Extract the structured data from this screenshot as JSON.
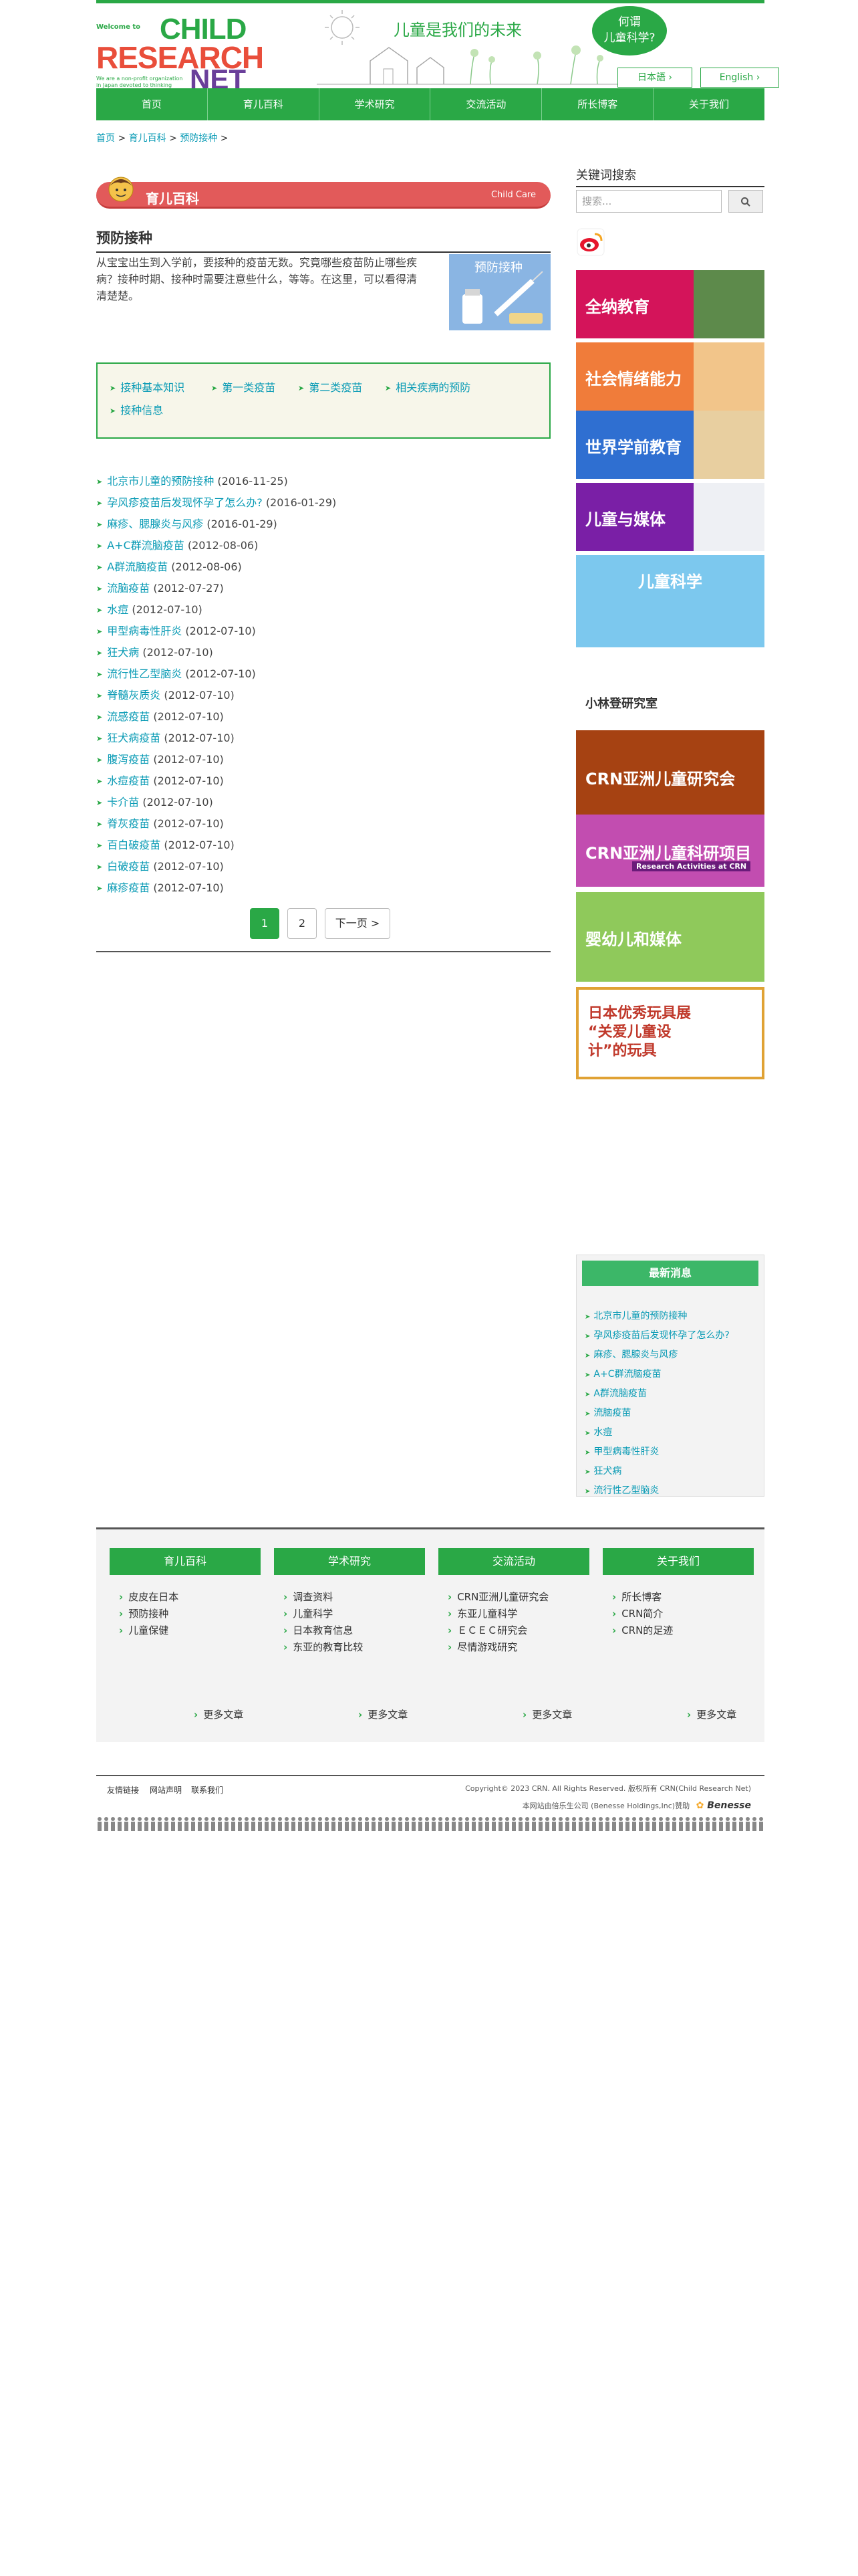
{
  "header": {
    "logo_small": "Welcome to",
    "logo_line1": "CHILD",
    "logo_line2": "RESEARCH",
    "logo_line3": "NET",
    "logo_tagline": "We are a non-profit organization in Japan devoted to thinking with and about children",
    "slogan": "儿童是我们的未来",
    "bubble_line1": "何谓",
    "bubble_line2": "儿童科学?",
    "lang_ja": "日本語 ›",
    "lang_en": "English ›"
  },
  "nav": [
    "首页",
    "育儿百科",
    "学术研究",
    "交流活动",
    "所长博客",
    "关于我们"
  ],
  "breadcrumb": [
    "首页",
    "育儿百科",
    "预防接种"
  ],
  "category": {
    "title": "育儿百科",
    "english": "Child Care"
  },
  "page": {
    "title": "预防接种",
    "intro": "从宝宝出生到入学前，要接种的疫苗无数。究竟哪些疫苗防止哪些疾病？接种时期、接种时需要注意些什么，等等。在这里，可以看得清清楚楚。",
    "image_label": "预防接种"
  },
  "subnav": [
    "接种基本知识",
    "第一类疫苗",
    "第二类疫苗",
    "相关疾病的预防",
    "接种信息"
  ],
  "articles": [
    {
      "title": "北京市儿童的预防接种",
      "date": "(2016-11-25)"
    },
    {
      "title": "孕风疹疫苗后发现怀孕了怎么办?",
      "date": "(2016-01-29)"
    },
    {
      "title": "麻疹、腮腺炎与风疹",
      "date": "(2016-01-29)"
    },
    {
      "title": "A+C群流脑疫苗",
      "date": "(2012-08-06)"
    },
    {
      "title": "A群流脑疫苗",
      "date": "(2012-08-06)"
    },
    {
      "title": "流脑疫苗",
      "date": "(2012-07-27)"
    },
    {
      "title": "水痘",
      "date": "(2012-07-10)"
    },
    {
      "title": "甲型病毒性肝炎",
      "date": "(2012-07-10)"
    },
    {
      "title": "狂犬病",
      "date": "(2012-07-10)"
    },
    {
      "title": "流行性乙型脑炎",
      "date": "(2012-07-10)"
    },
    {
      "title": "脊髓灰质炎",
      "date": "(2012-07-10)"
    },
    {
      "title": "流感疫苗",
      "date": "(2012-07-10)"
    },
    {
      "title": "狂犬病疫苗",
      "date": "(2012-07-10)"
    },
    {
      "title": "腹泻疫苗",
      "date": "(2012-07-10)"
    },
    {
      "title": "水痘疫苗",
      "date": "(2012-07-10)"
    },
    {
      "title": "卡介苗",
      "date": "(2012-07-10)"
    },
    {
      "title": "脊灰疫苗",
      "date": "(2012-07-10)"
    },
    {
      "title": "百白破疫苗",
      "date": "(2012-07-10)"
    },
    {
      "title": "白破疫苗",
      "date": "(2012-07-10)"
    },
    {
      "title": "麻疹疫苗",
      "date": "(2012-07-10)"
    }
  ],
  "pagination": {
    "current": "1",
    "next_page": "2",
    "next_label": "下一页 >"
  },
  "sidebar": {
    "keyword_title": "关键词搜索",
    "search_placeholder": "搜索...",
    "banners": [
      {
        "label": "全纳教育",
        "color": "#d4145a"
      },
      {
        "label": "社会情绪能力",
        "color": "#f07c3a"
      },
      {
        "label": "世界学前教育",
        "color": "#2f6fd1"
      },
      {
        "label": "儿童与媒体",
        "color": "#7a1fa6"
      },
      {
        "label": "儿童科学",
        "color": "#7cc8ee"
      },
      {
        "label": "小林登研究室",
        "color": "#ffffff"
      },
      {
        "label": "CRN亚洲儿童研究会",
        "color": "#a64212"
      },
      {
        "label": "CRN亚洲儿童科研项目",
        "color": "#c24db0"
      },
      {
        "label": "婴幼儿和媒体",
        "color": "#8fc95b"
      },
      {
        "label": "日本优秀玩具展 “关爱儿童设计”的玩具",
        "color": "#e0a234"
      }
    ],
    "banner_sub": "Research Activities at CRN",
    "news_title": "最新消息",
    "news": [
      "北京市儿童的预防接种",
      "孕风疹疫苗后发现怀孕了怎么办?",
      "麻疹、腮腺炎与风疹",
      "A+C群流脑疫苗",
      "A群流脑疫苗",
      "流脑疫苗",
      "水痘",
      "甲型病毒性肝炎",
      "狂犬病",
      "流行性乙型脑炎"
    ]
  },
  "footer": {
    "cols": [
      {
        "title": "育儿百科",
        "links": [
          "皮皮在日本",
          "预防接种",
          "儿童保健"
        ]
      },
      {
        "title": "学术研究",
        "links": [
          "调查资料",
          "儿童科学",
          "日本教育信息",
          "东亚的教育比较"
        ]
      },
      {
        "title": "交流活动",
        "links": [
          "CRN亚洲儿童研究会",
          "东亚儿童科学",
          "ＥＣＥＣ研究会",
          "尽情游戏研究"
        ]
      },
      {
        "title": "关于我们",
        "links": [
          "所长博客",
          "CRN简介",
          "CRN的足迹"
        ]
      }
    ],
    "more": "更多文章",
    "bottom_links": [
      "友情链接",
      "网站声明",
      "联系我们"
    ],
    "copyright": "Copyright© 2023 CRN. All Rights Reserved. 版权所有 CRN(Child Research Net)",
    "owner": "本网站由倍乐生公司 (Benesse Holdings,Inc)赞助",
    "benesse": "Benesse"
  }
}
